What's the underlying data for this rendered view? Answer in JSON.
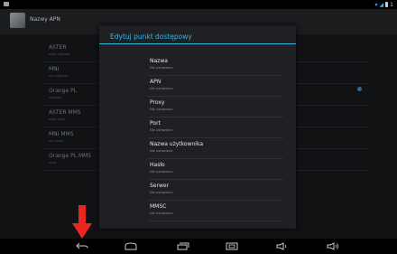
{
  "app": {
    "title": "Nazwy APN"
  },
  "background_list": [
    {
      "name": "ASTER",
      "sub": "aster.internet"
    },
    {
      "name": "MNI",
      "sub": "mni.internet"
    },
    {
      "name": "Orange PL",
      "sub": "internet"
    },
    {
      "name": "ASTER MMS",
      "sub": "aster.mms"
    },
    {
      "name": "MNI MMS",
      "sub": "mni.mms"
    },
    {
      "name": "Orange PL MMS",
      "sub": "mms"
    }
  ],
  "dialog": {
    "title": "Edytuj punkt dostępowy",
    "items": [
      {
        "label": "Nazwa",
        "value": "Nie ustawiono"
      },
      {
        "label": "APN",
        "value": "Nie ustawiono"
      },
      {
        "label": "Proxy",
        "value": "Nie ustawiono"
      },
      {
        "label": "Port",
        "value": "Nie ustawiono"
      },
      {
        "label": "Nazwa użytkownika",
        "value": "Nie ustawiono"
      },
      {
        "label": "Hasło",
        "value": "Nie ustawiono"
      },
      {
        "label": "Serwer",
        "value": "Nie ustawiono"
      },
      {
        "label": "MMSC",
        "value": "Nie ustawiono"
      }
    ]
  },
  "nav": [
    "back-icon",
    "home-icon",
    "recent-apps-icon",
    "screenshot-icon",
    "volume-down-icon",
    "volume-up-icon"
  ],
  "colors": {
    "accent": "#33b5e5",
    "annotation": "#e8281e"
  }
}
